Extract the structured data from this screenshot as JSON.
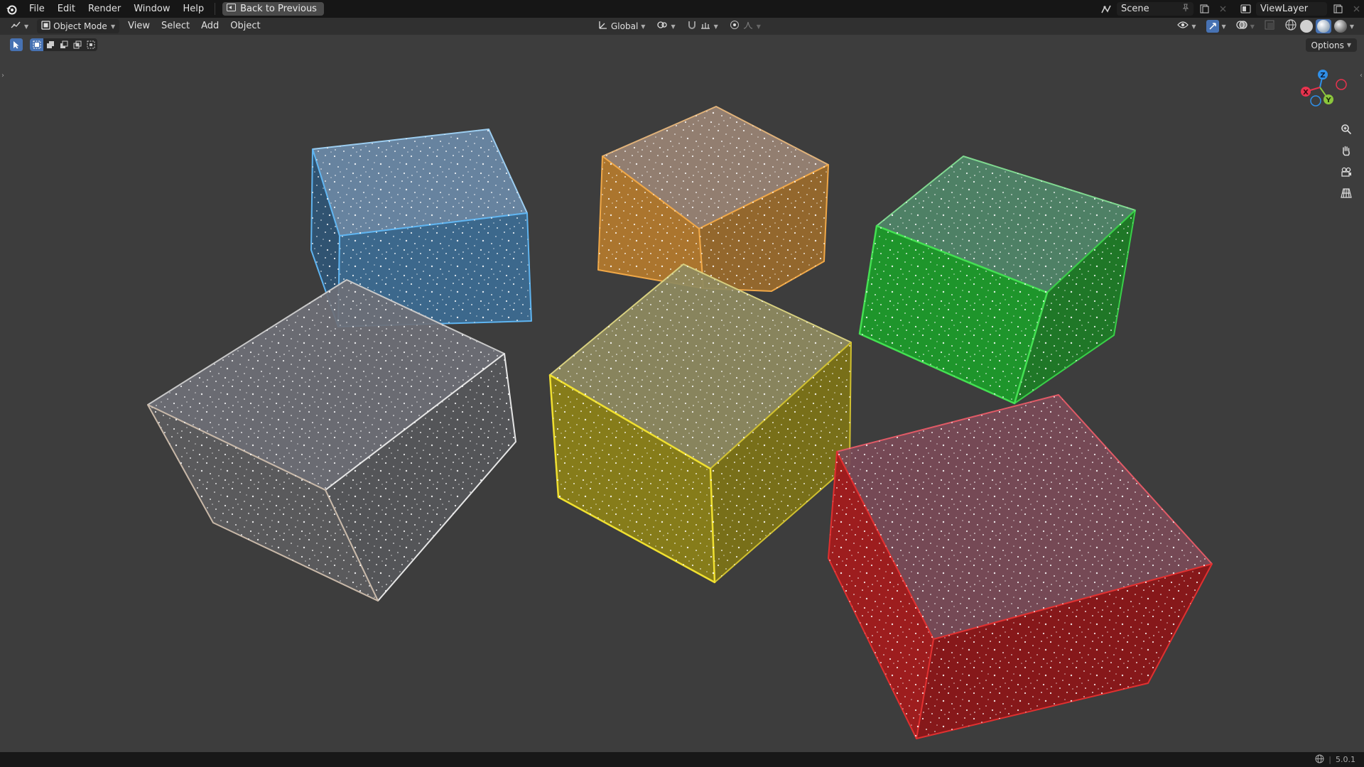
{
  "menu": {
    "items": [
      "File",
      "Edit",
      "Render",
      "Window",
      "Help"
    ],
    "back_button": "Back to Previous"
  },
  "top_right": {
    "scene_name": "Scene",
    "view_layer_name": "ViewLayer"
  },
  "header": {
    "mode": "Object Mode",
    "menus": [
      "View",
      "Select",
      "Add",
      "Object"
    ],
    "transform_orientation": "Global"
  },
  "toolbar": {
    "options_label": "Options"
  },
  "gizmo": {
    "x_label": "X",
    "y_label": "Y",
    "z_label": "Z",
    "x_color": "#e8334e",
    "y_color": "#8bc63c",
    "z_color": "#2f8fe8"
  },
  "scene": {
    "background_color": "#3d3d3d",
    "cubes": [
      {
        "name": "blue-cube",
        "color": "#6b9bd0"
      },
      {
        "name": "orange-cube",
        "color": "#d99a48"
      },
      {
        "name": "green-cube",
        "color": "#2fbe3a"
      },
      {
        "name": "clear-cube",
        "color": "#b8b8b8"
      },
      {
        "name": "yellow-cube",
        "color": "#d8c42c"
      },
      {
        "name": "red-cube",
        "color": "#c42a2a"
      }
    ]
  },
  "status": {
    "version": "5.0.1"
  }
}
